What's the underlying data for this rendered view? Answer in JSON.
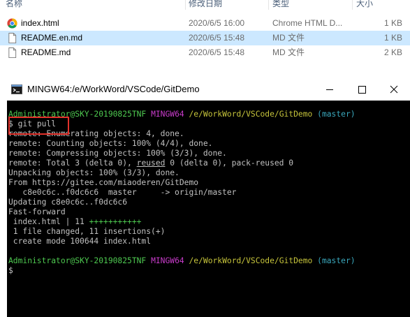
{
  "explorer": {
    "columns": {
      "name": "名称",
      "date": "修改日期",
      "type": "类型",
      "size": "大小"
    },
    "files": [
      {
        "name": "index.html",
        "date": "2020/6/5 16:00",
        "type": "Chrome HTML D...",
        "size": "1 KB",
        "icon": "chrome-icon"
      },
      {
        "name": "README.en.md",
        "date": "2020/6/5 15:48",
        "type": "MD 文件",
        "size": "1 KB",
        "icon": "document-icon"
      },
      {
        "name": "README.md",
        "date": "2020/6/5 15:48",
        "type": "MD 文件",
        "size": "2 KB",
        "icon": "document-icon"
      }
    ]
  },
  "terminal": {
    "title": "MINGW64:/e/WorkWord/VSCode/GitDemo",
    "prompt": {
      "user_host": "Administrator@SKY-20190825TNF",
      "env": "MINGW64",
      "path": "/e/WorkWord/VSCode/GitDemo",
      "branch": "(master)"
    },
    "command_prefix": "$ ",
    "command": "git pull",
    "output": [
      "remote: Enumerating objects: 4, done.",
      "remote: Counting objects: 100% (4/4), done.",
      "remote: Compressing objects: 100% (3/3), done.",
      "remote: Total 3 (delta 0), ",
      "Unpacking objects: 100% (3/3), done.",
      "From https://gitee.com/miaoderen/GitDemo",
      "   c8e0c6c..f0dc6c6  master     -> origin/master",
      "Updating c8e0c6c..f0dc6c6",
      "Fast-forward",
      " index.html | 11 ",
      " 1 file changed, 11 insertions(+)",
      " create mode 100644 index.html"
    ],
    "reused_word": "reused",
    "total_suffix": " 0 (delta 0), pack-reused 0",
    "plus_marks": "+++++++++++",
    "final_prompt": "$"
  },
  "colors": {
    "selection": "#cce8ff",
    "highlight_box": "#e3322b",
    "prompt_green": "#4ec950",
    "prompt_magenta": "#c93ccb",
    "prompt_yellow": "#c6c43b",
    "branch_cyan": "#3aa8bd"
  }
}
